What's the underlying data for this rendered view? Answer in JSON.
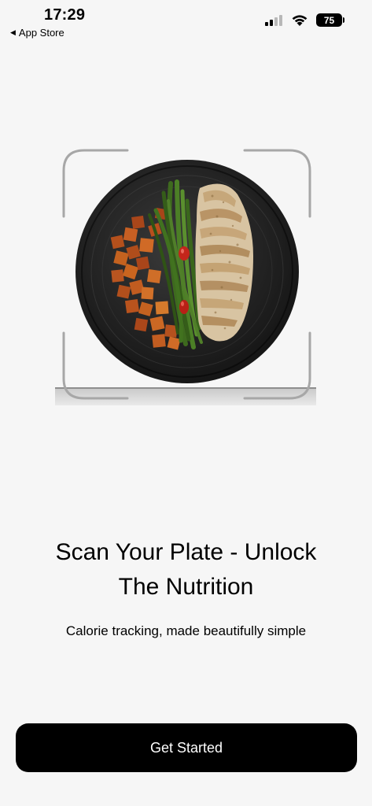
{
  "status_bar": {
    "time": "17:29",
    "back_label": "App Store",
    "battery_level": "75"
  },
  "onboarding": {
    "headline_line1": "Scan Your Plate - Unlock",
    "headline_line2": "The Nutrition",
    "subheadline": "Calorie tracking, made beautifully simple",
    "cta_label": "Get Started"
  },
  "colors": {
    "background": "#f6f6f6",
    "button": "#000000",
    "button_text": "#ffffff",
    "scan_frame": "#a7a7a7"
  },
  "icons": {
    "back": "back-caret-icon",
    "signal": "cellular-signal-icon",
    "wifi": "wifi-icon",
    "battery": "battery-icon"
  }
}
